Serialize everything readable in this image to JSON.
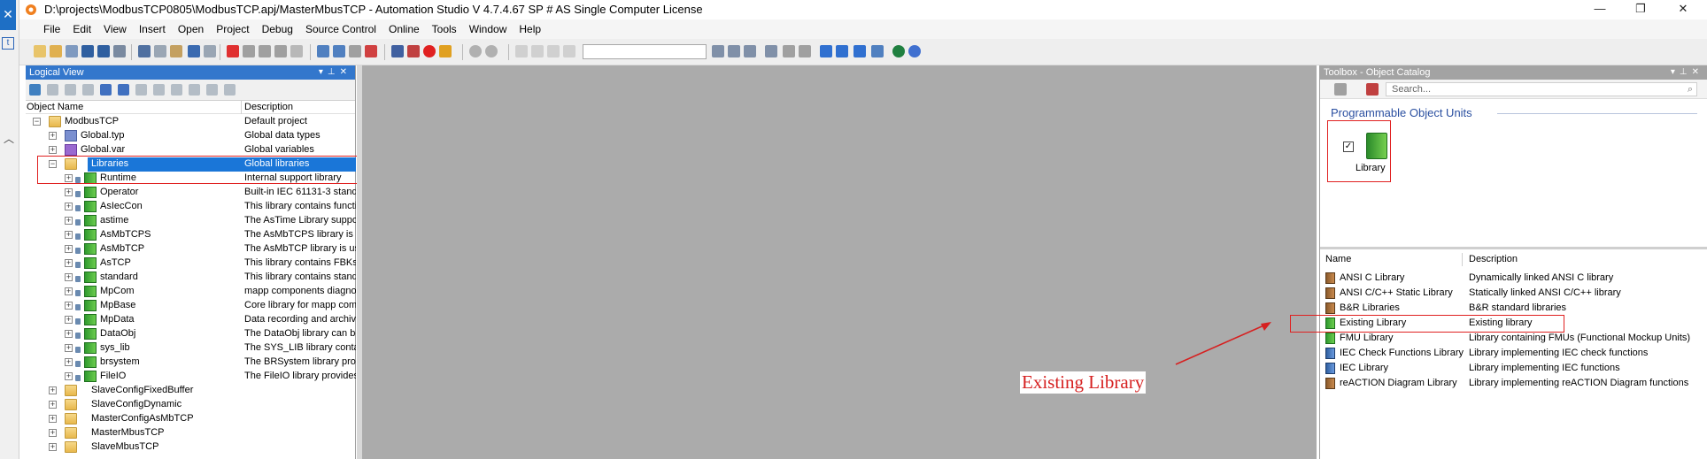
{
  "window": {
    "title": "D:\\projects\\ModbusTCP0805\\ModbusTCP.apj/MasterMbusTCP - Automation Studio V 4.7.4.67 SP # AS Single Computer License"
  },
  "menu": [
    "File",
    "Edit",
    "View",
    "Insert",
    "Open",
    "Project",
    "Debug",
    "Source Control",
    "Online",
    "Tools",
    "Window",
    "Help"
  ],
  "logical_view": {
    "title": "Logical View",
    "col_name": "Object Name",
    "col_desc": "Description",
    "rows": [
      {
        "name": "ModbusTCP",
        "desc": "Default project"
      },
      {
        "name": "Global.typ",
        "desc": "Global data types"
      },
      {
        "name": "Global.var",
        "desc": "Global variables"
      },
      {
        "name": "Libraries",
        "desc": "Global libraries"
      },
      {
        "name": "Runtime",
        "desc": "Internal support library"
      },
      {
        "name": "Operator",
        "desc": "Built-in IEC 61131-3 standa"
      },
      {
        "name": "AsIecCon",
        "desc": "This library contains functic"
      },
      {
        "name": "astime",
        "desc": "The AsTime Library suppor"
      },
      {
        "name": "AsMbTCPS",
        "desc": "The AsMbTCPS library is u"
      },
      {
        "name": "AsMbTCP",
        "desc": "The AsMbTCP library is us"
      },
      {
        "name": "AsTCP",
        "desc": "This library contains FBKs f"
      },
      {
        "name": "standard",
        "desc": "This library contains standa"
      },
      {
        "name": "MpCom",
        "desc": "mapp components diagnos"
      },
      {
        "name": "MpBase",
        "desc": "Core library for mapp comp"
      },
      {
        "name": "MpData",
        "desc": "Data recording and archivi"
      },
      {
        "name": "DataObj",
        "desc": "The DataObj library can be"
      },
      {
        "name": "sys_lib",
        "desc": "The SYS_LIB library conta"
      },
      {
        "name": "brsystem",
        "desc": "The BRSystem library prov"
      },
      {
        "name": "FileIO",
        "desc": "The FileIO library provides"
      },
      {
        "name": "SlaveConfigFixedBuffer",
        "desc": ""
      },
      {
        "name": "SlaveConfigDynamic",
        "desc": ""
      },
      {
        "name": "MasterConfigAsMbTCP",
        "desc": ""
      },
      {
        "name": "MasterMbusTCP",
        "desc": ""
      },
      {
        "name": "SlaveMbusTCP",
        "desc": ""
      }
    ]
  },
  "toolbox": {
    "title": "Toolbox - Object Catalog",
    "search_placeholder": "Search...",
    "pou_heading": "Programmable Object Units",
    "pou_item": "Library",
    "col_name": "Name",
    "col_desc": "Description",
    "items": [
      {
        "name": "ANSI C Library",
        "desc": "Dynamically linked ANSI C library"
      },
      {
        "name": "ANSI C/C++ Static Library",
        "desc": "Statically linked ANSI C/C++ library"
      },
      {
        "name": "B&R Libraries",
        "desc": "B&R standard libraries"
      },
      {
        "name": "Existing Library",
        "desc": "Existing library"
      },
      {
        "name": "FMU Library",
        "desc": "Library containing FMUs (Functional Mockup Units)"
      },
      {
        "name": "IEC Check Functions Library",
        "desc": "Library implementing IEC check functions"
      },
      {
        "name": "IEC Library",
        "desc": "Library implementing IEC functions"
      },
      {
        "name": "reACTION Diagram Library",
        "desc": "Library implementing reACTION Diagram functions"
      }
    ]
  },
  "annotation": {
    "text": "Existing Library",
    "color": "#d62020"
  },
  "colors": {
    "selection": "#1a76d8",
    "panel_head_active": "#3377cc",
    "workspace": "#ababab"
  }
}
